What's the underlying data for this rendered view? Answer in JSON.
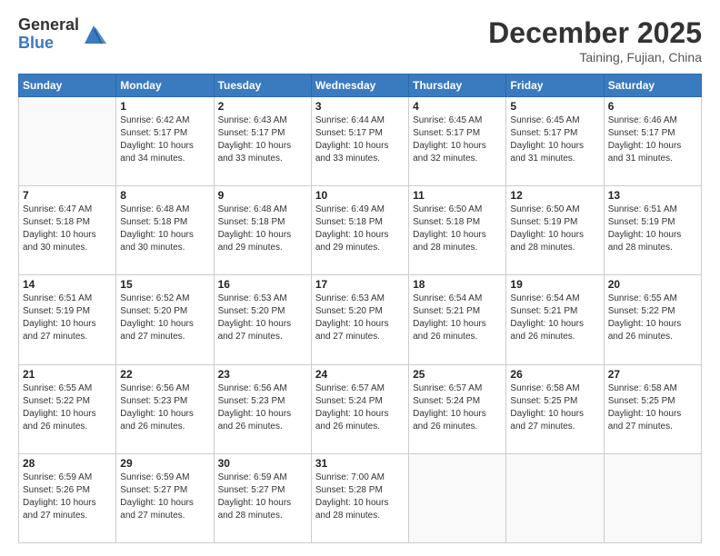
{
  "logo": {
    "general": "General",
    "blue": "Blue"
  },
  "header": {
    "month": "December 2025",
    "location": "Taining, Fujian, China"
  },
  "weekdays": [
    "Sunday",
    "Monday",
    "Tuesday",
    "Wednesday",
    "Thursday",
    "Friday",
    "Saturday"
  ],
  "weeks": [
    [
      {
        "date": "",
        "sunrise": "",
        "sunset": "",
        "daylight": ""
      },
      {
        "date": "1",
        "sunrise": "Sunrise: 6:42 AM",
        "sunset": "Sunset: 5:17 PM",
        "daylight": "Daylight: 10 hours and 34 minutes."
      },
      {
        "date": "2",
        "sunrise": "Sunrise: 6:43 AM",
        "sunset": "Sunset: 5:17 PM",
        "daylight": "Daylight: 10 hours and 33 minutes."
      },
      {
        "date": "3",
        "sunrise": "Sunrise: 6:44 AM",
        "sunset": "Sunset: 5:17 PM",
        "daylight": "Daylight: 10 hours and 33 minutes."
      },
      {
        "date": "4",
        "sunrise": "Sunrise: 6:45 AM",
        "sunset": "Sunset: 5:17 PM",
        "daylight": "Daylight: 10 hours and 32 minutes."
      },
      {
        "date": "5",
        "sunrise": "Sunrise: 6:45 AM",
        "sunset": "Sunset: 5:17 PM",
        "daylight": "Daylight: 10 hours and 31 minutes."
      },
      {
        "date": "6",
        "sunrise": "Sunrise: 6:46 AM",
        "sunset": "Sunset: 5:17 PM",
        "daylight": "Daylight: 10 hours and 31 minutes."
      }
    ],
    [
      {
        "date": "7",
        "sunrise": "Sunrise: 6:47 AM",
        "sunset": "Sunset: 5:18 PM",
        "daylight": "Daylight: 10 hours and 30 minutes."
      },
      {
        "date": "8",
        "sunrise": "Sunrise: 6:48 AM",
        "sunset": "Sunset: 5:18 PM",
        "daylight": "Daylight: 10 hours and 30 minutes."
      },
      {
        "date": "9",
        "sunrise": "Sunrise: 6:48 AM",
        "sunset": "Sunset: 5:18 PM",
        "daylight": "Daylight: 10 hours and 29 minutes."
      },
      {
        "date": "10",
        "sunrise": "Sunrise: 6:49 AM",
        "sunset": "Sunset: 5:18 PM",
        "daylight": "Daylight: 10 hours and 29 minutes."
      },
      {
        "date": "11",
        "sunrise": "Sunrise: 6:50 AM",
        "sunset": "Sunset: 5:18 PM",
        "daylight": "Daylight: 10 hours and 28 minutes."
      },
      {
        "date": "12",
        "sunrise": "Sunrise: 6:50 AM",
        "sunset": "Sunset: 5:19 PM",
        "daylight": "Daylight: 10 hours and 28 minutes."
      },
      {
        "date": "13",
        "sunrise": "Sunrise: 6:51 AM",
        "sunset": "Sunset: 5:19 PM",
        "daylight": "Daylight: 10 hours and 28 minutes."
      }
    ],
    [
      {
        "date": "14",
        "sunrise": "Sunrise: 6:51 AM",
        "sunset": "Sunset: 5:19 PM",
        "daylight": "Daylight: 10 hours and 27 minutes."
      },
      {
        "date": "15",
        "sunrise": "Sunrise: 6:52 AM",
        "sunset": "Sunset: 5:20 PM",
        "daylight": "Daylight: 10 hours and 27 minutes."
      },
      {
        "date": "16",
        "sunrise": "Sunrise: 6:53 AM",
        "sunset": "Sunset: 5:20 PM",
        "daylight": "Daylight: 10 hours and 27 minutes."
      },
      {
        "date": "17",
        "sunrise": "Sunrise: 6:53 AM",
        "sunset": "Sunset: 5:20 PM",
        "daylight": "Daylight: 10 hours and 27 minutes."
      },
      {
        "date": "18",
        "sunrise": "Sunrise: 6:54 AM",
        "sunset": "Sunset: 5:21 PM",
        "daylight": "Daylight: 10 hours and 26 minutes."
      },
      {
        "date": "19",
        "sunrise": "Sunrise: 6:54 AM",
        "sunset": "Sunset: 5:21 PM",
        "daylight": "Daylight: 10 hours and 26 minutes."
      },
      {
        "date": "20",
        "sunrise": "Sunrise: 6:55 AM",
        "sunset": "Sunset: 5:22 PM",
        "daylight": "Daylight: 10 hours and 26 minutes."
      }
    ],
    [
      {
        "date": "21",
        "sunrise": "Sunrise: 6:55 AM",
        "sunset": "Sunset: 5:22 PM",
        "daylight": "Daylight: 10 hours and 26 minutes."
      },
      {
        "date": "22",
        "sunrise": "Sunrise: 6:56 AM",
        "sunset": "Sunset: 5:23 PM",
        "daylight": "Daylight: 10 hours and 26 minutes."
      },
      {
        "date": "23",
        "sunrise": "Sunrise: 6:56 AM",
        "sunset": "Sunset: 5:23 PM",
        "daylight": "Daylight: 10 hours and 26 minutes."
      },
      {
        "date": "24",
        "sunrise": "Sunrise: 6:57 AM",
        "sunset": "Sunset: 5:24 PM",
        "daylight": "Daylight: 10 hours and 26 minutes."
      },
      {
        "date": "25",
        "sunrise": "Sunrise: 6:57 AM",
        "sunset": "Sunset: 5:24 PM",
        "daylight": "Daylight: 10 hours and 26 minutes."
      },
      {
        "date": "26",
        "sunrise": "Sunrise: 6:58 AM",
        "sunset": "Sunset: 5:25 PM",
        "daylight": "Daylight: 10 hours and 27 minutes."
      },
      {
        "date": "27",
        "sunrise": "Sunrise: 6:58 AM",
        "sunset": "Sunset: 5:25 PM",
        "daylight": "Daylight: 10 hours and 27 minutes."
      }
    ],
    [
      {
        "date": "28",
        "sunrise": "Sunrise: 6:59 AM",
        "sunset": "Sunset: 5:26 PM",
        "daylight": "Daylight: 10 hours and 27 minutes."
      },
      {
        "date": "29",
        "sunrise": "Sunrise: 6:59 AM",
        "sunset": "Sunset: 5:27 PM",
        "daylight": "Daylight: 10 hours and 27 minutes."
      },
      {
        "date": "30",
        "sunrise": "Sunrise: 6:59 AM",
        "sunset": "Sunset: 5:27 PM",
        "daylight": "Daylight: 10 hours and 28 minutes."
      },
      {
        "date": "31",
        "sunrise": "Sunrise: 7:00 AM",
        "sunset": "Sunset: 5:28 PM",
        "daylight": "Daylight: 10 hours and 28 minutes."
      },
      {
        "date": "",
        "sunrise": "",
        "sunset": "",
        "daylight": ""
      },
      {
        "date": "",
        "sunrise": "",
        "sunset": "",
        "daylight": ""
      },
      {
        "date": "",
        "sunrise": "",
        "sunset": "",
        "daylight": ""
      }
    ]
  ]
}
